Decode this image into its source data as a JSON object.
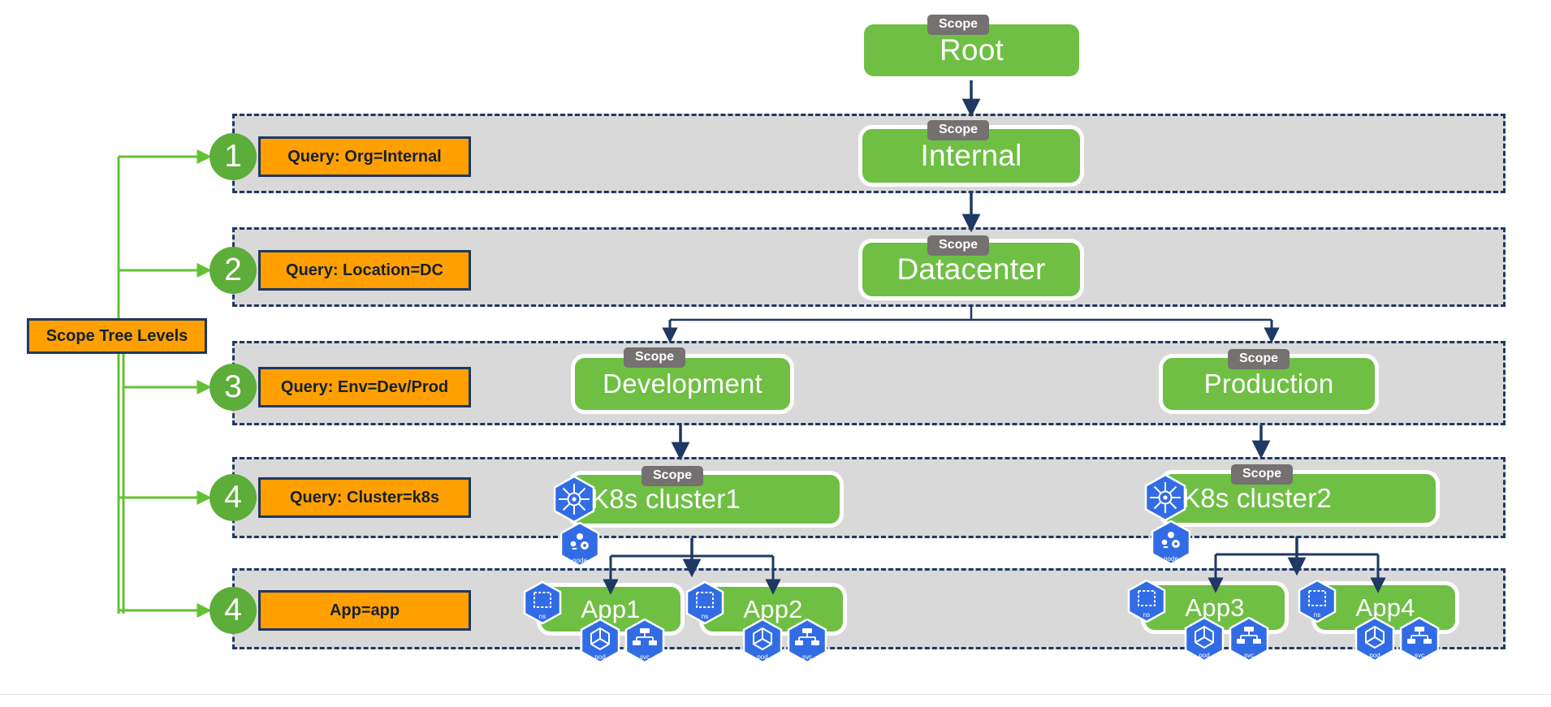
{
  "diagram": {
    "title_box": {
      "label": "Scope Tree Levels"
    },
    "scope_tag_label": "Scope",
    "levels": [
      {
        "number": "1",
        "query": "Query: Org=Internal"
      },
      {
        "number": "2",
        "query": "Query: Location=DC"
      },
      {
        "number": "3",
        "query": "Query: Env=Dev/Prod"
      },
      {
        "number": "4",
        "query": "Query: Cluster=k8s"
      },
      {
        "number": "4",
        "query": "App=app"
      }
    ],
    "nodes": {
      "root": "Root",
      "internal": "Internal",
      "datacenter": "Datacenter",
      "development": "Development",
      "production": "Production",
      "cluster1": "K8s cluster1",
      "cluster2": "K8s cluster2",
      "app1": "App1",
      "app2": "App2",
      "app3": "App3",
      "app4": "App4"
    },
    "k8s_icon_labels": {
      "cluster": "",
      "node": "node",
      "ns": "ns",
      "pod": "pod",
      "svc": "svc"
    },
    "colors": {
      "scope_green": "#6FBF44",
      "circle_green": "#5CAD39",
      "connector_green": "#63C132",
      "query_orange": "#FFA000",
      "lane_gray": "#D9D9D9",
      "outline_navy": "#1F3864",
      "scope_tag_gray": "#767171",
      "k8s_blue": "#326CE5"
    }
  }
}
